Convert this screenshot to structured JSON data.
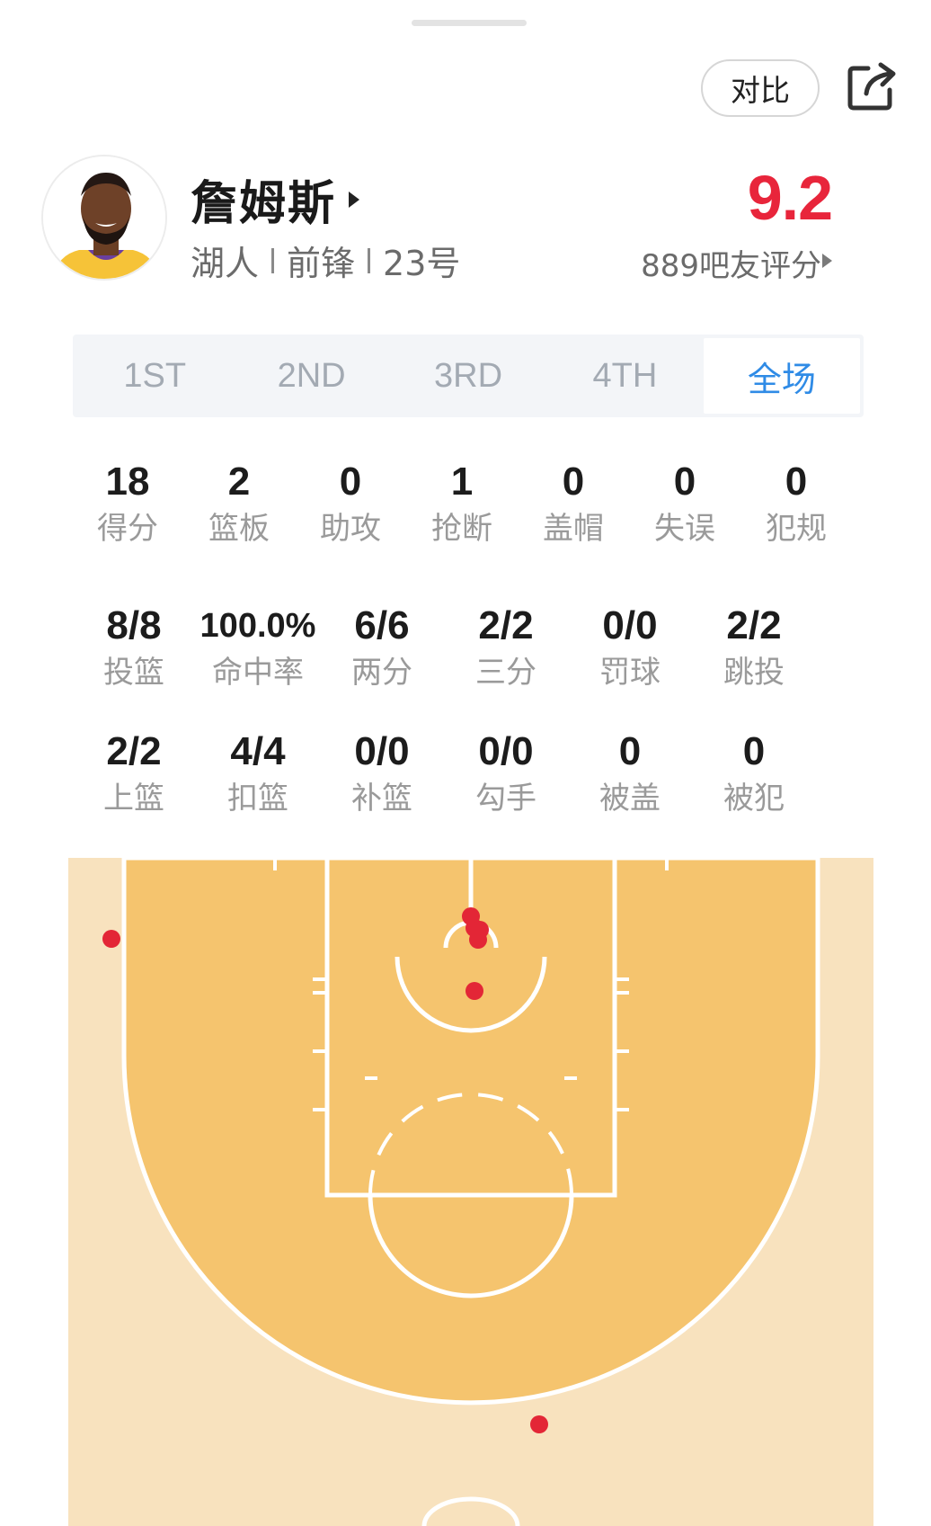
{
  "actions": {
    "compare_label": "对比"
  },
  "player": {
    "name": "詹姆斯",
    "team": "湖人",
    "position": "前锋",
    "number": "23号",
    "rating": "9.2",
    "rating_count_label": "889吧友评分"
  },
  "tabs": [
    {
      "label": "1ST",
      "active": false
    },
    {
      "label": "2ND",
      "active": false
    },
    {
      "label": "3RD",
      "active": false
    },
    {
      "label": "4TH",
      "active": false
    },
    {
      "label": "全场",
      "active": true
    }
  ],
  "basic_stats": [
    {
      "value": "18",
      "label": "得分"
    },
    {
      "value": "2",
      "label": "篮板"
    },
    {
      "value": "0",
      "label": "助攻"
    },
    {
      "value": "1",
      "label": "抢断"
    },
    {
      "value": "0",
      "label": "盖帽"
    },
    {
      "value": "0",
      "label": "失误"
    },
    {
      "value": "0",
      "label": "犯规"
    }
  ],
  "shooting_stats": [
    {
      "value": "8/8",
      "label": "投篮"
    },
    {
      "value": "100.0%",
      "label": "命中率"
    },
    {
      "value": "6/6",
      "label": "两分"
    },
    {
      "value": "2/2",
      "label": "三分"
    },
    {
      "value": "0/0",
      "label": "罚球"
    },
    {
      "value": "2/2",
      "label": "跳投"
    }
  ],
  "shot_type_stats": [
    {
      "value": "2/2",
      "label": "上篮"
    },
    {
      "value": "4/4",
      "label": "扣篮"
    },
    {
      "value": "0/0",
      "label": "补篮"
    },
    {
      "value": "0/0",
      "label": "勾手"
    },
    {
      "value": "0",
      "label": "被盖"
    },
    {
      "value": "0",
      "label": "被犯"
    }
  ],
  "colors": {
    "accent_blue": "#2f8be6",
    "rating_red": "#e8253b",
    "shot_dot": "#e32636",
    "court_outer": "#f8e2be",
    "court_inner": "#f5c46e"
  }
}
